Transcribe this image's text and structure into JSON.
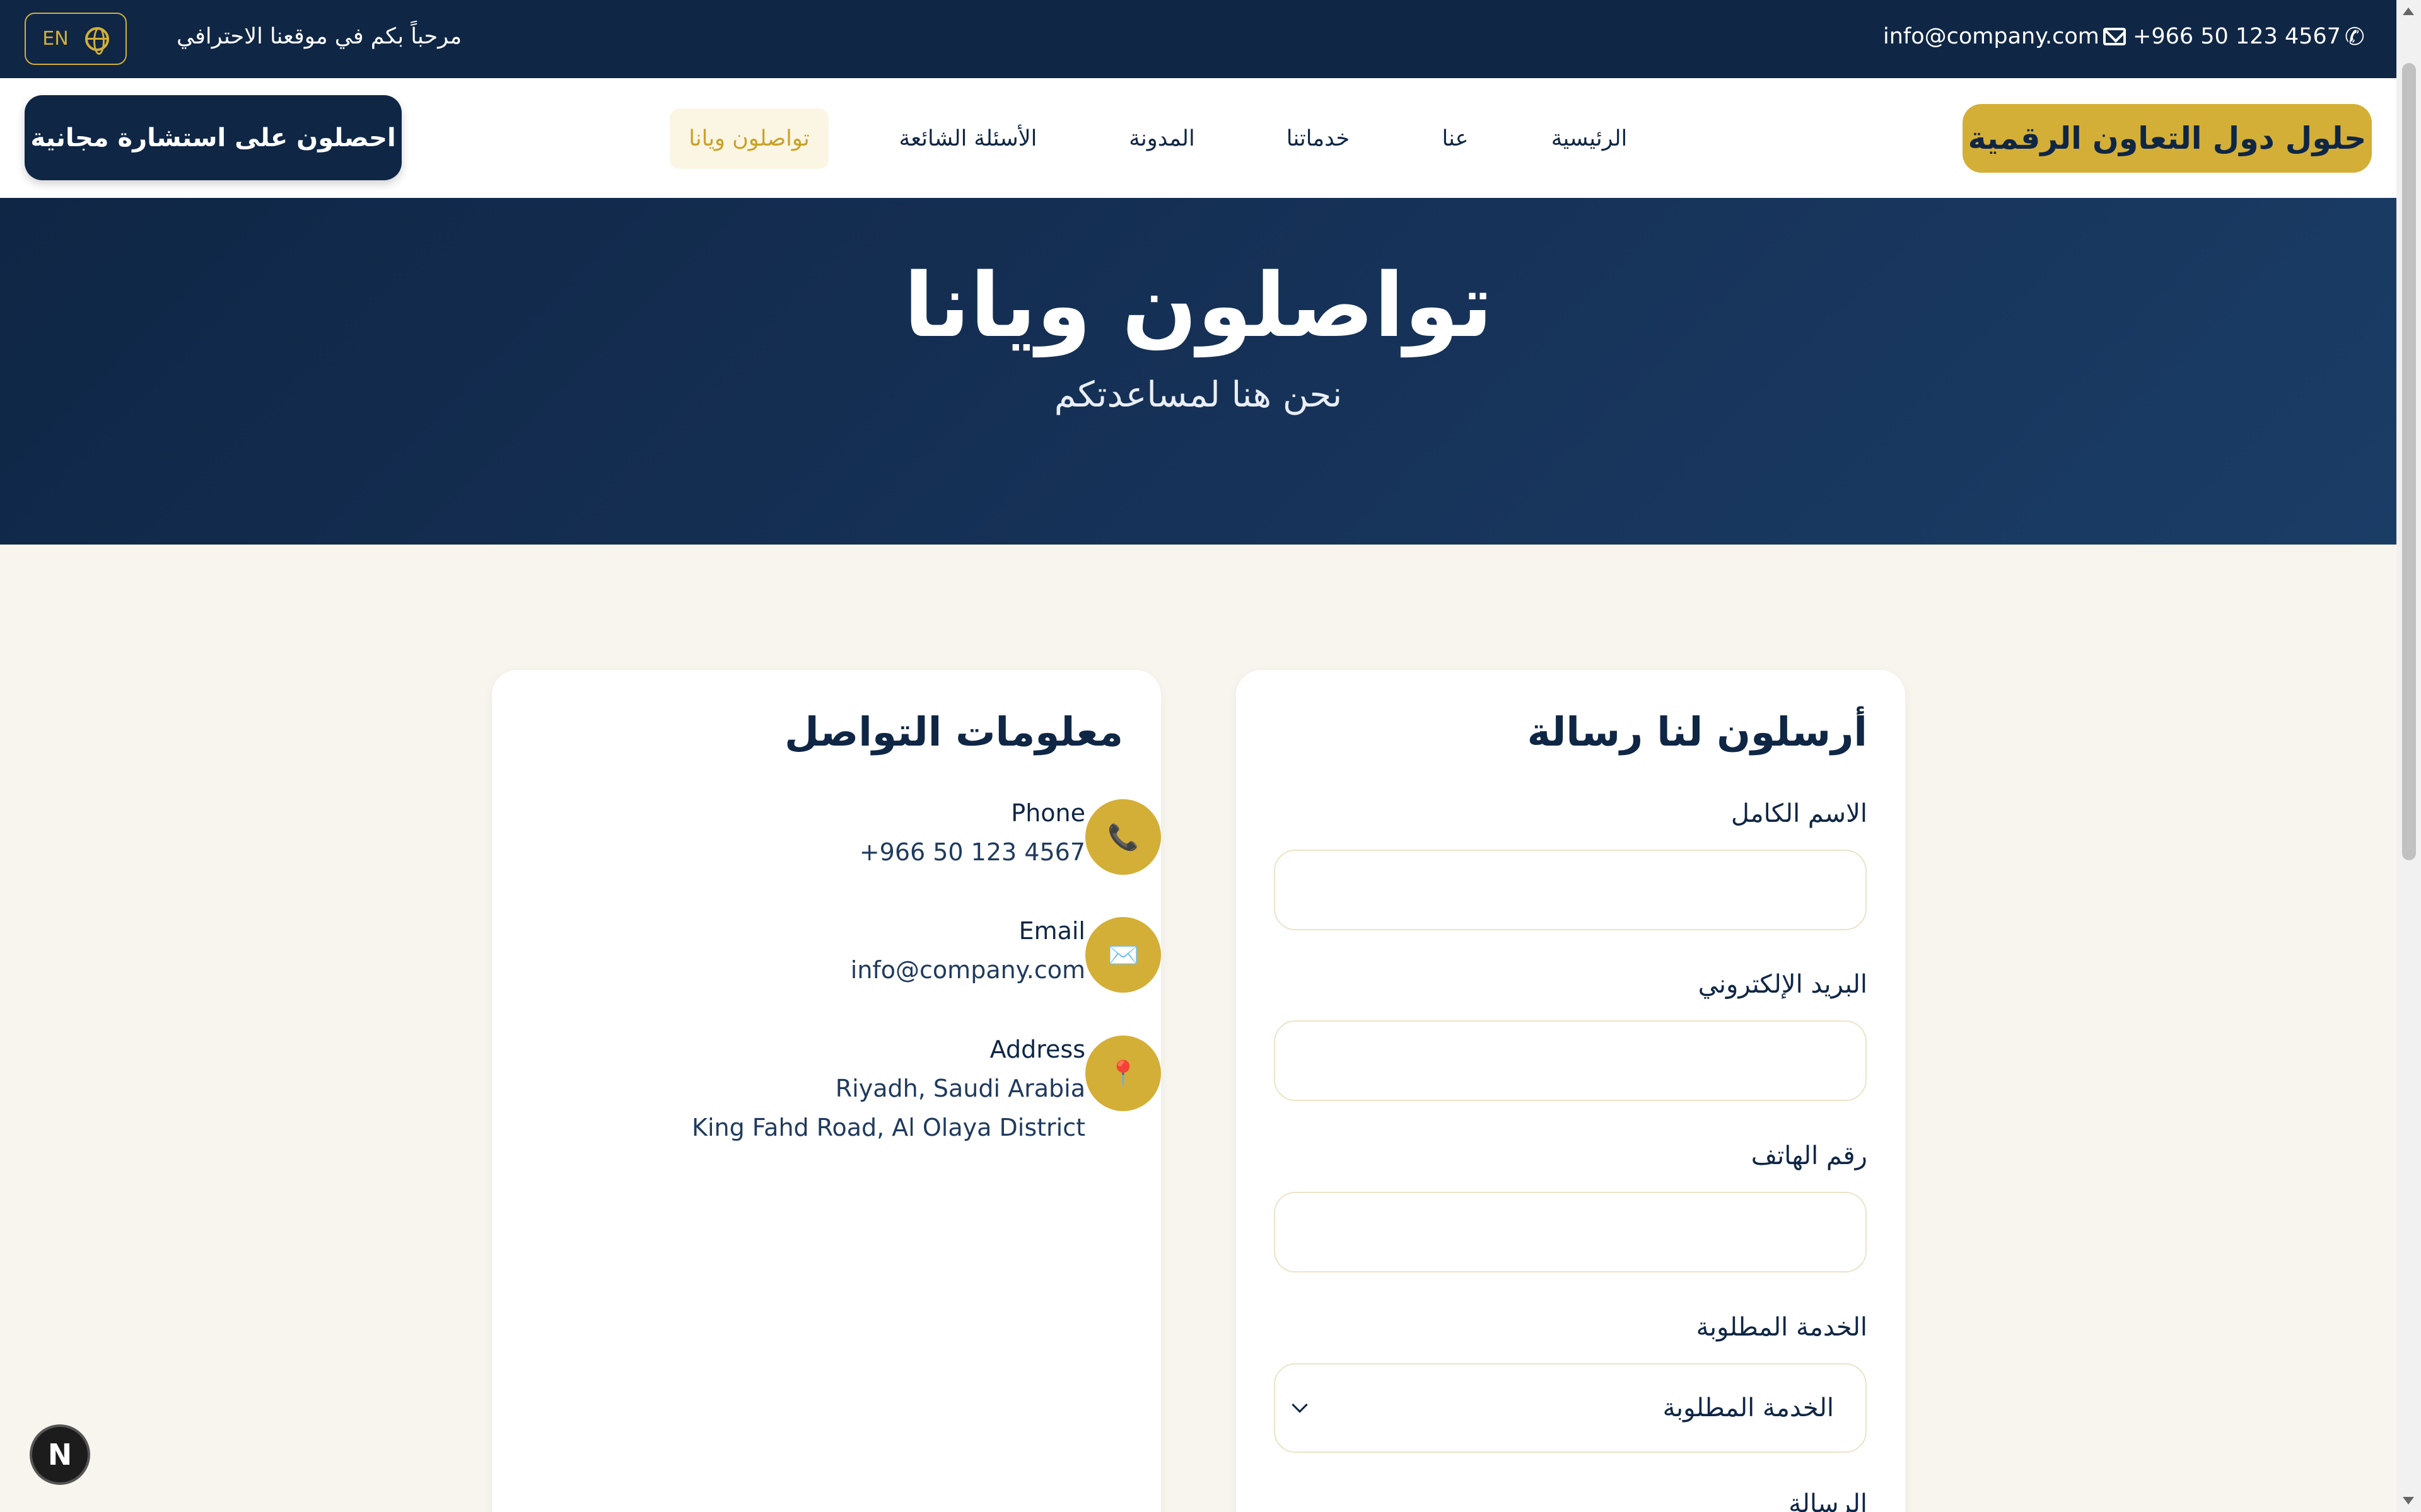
{
  "topbar": {
    "lang_label": "EN",
    "welcome": "مرحباً بكم في موقعنا الاحترافي",
    "email": "info@company.com",
    "phone": "+966 50 123 4567"
  },
  "nav": {
    "cta_label": "احصلون على استشارة مجانية",
    "items": [
      {
        "label": "الرئيسية"
      },
      {
        "label": "عنا"
      },
      {
        "label": "خدماتنا"
      },
      {
        "label": "المدونة"
      },
      {
        "label": "الأسئلة الشائعة"
      },
      {
        "label": "تواصلون ويانا"
      }
    ],
    "active_index": 5,
    "brand": "حلول دول التعاون الرقمية"
  },
  "hero": {
    "title": "تواصلون ويانا",
    "subtitle": "نحن هنا لمساعدتكم"
  },
  "info_card": {
    "title": "معلومات التواصل",
    "items": [
      {
        "icon": "phone-icon",
        "glyph": "📞",
        "label": "Phone",
        "value": "+966 50 123 4567",
        "value2": ""
      },
      {
        "icon": "email-icon",
        "glyph": "✉️",
        "label": "Email",
        "value": "info@company.com",
        "value2": ""
      },
      {
        "icon": "location-pin-icon",
        "glyph": "📍",
        "label": "Address",
        "value": "Riyadh, Saudi Arabia",
        "value2": "King Fahd Road, Al Olaya District"
      }
    ]
  },
  "form_card": {
    "title": "أرسلون لنا رسالة",
    "fields": [
      {
        "label": "الاسم الكامل",
        "value": ""
      },
      {
        "label": "البريد الإلكتروني",
        "value": ""
      },
      {
        "label": "رقم الهاتف",
        "value": ""
      }
    ],
    "service_label": "الخدمة المطلوبة",
    "service_selected": "الخدمة المطلوبة",
    "message_label": "الرسالة"
  },
  "dev_badge": "N",
  "colors": {
    "navy": "#0f2645",
    "gold": "#d4af37",
    "cream": "#f8f5ee"
  }
}
